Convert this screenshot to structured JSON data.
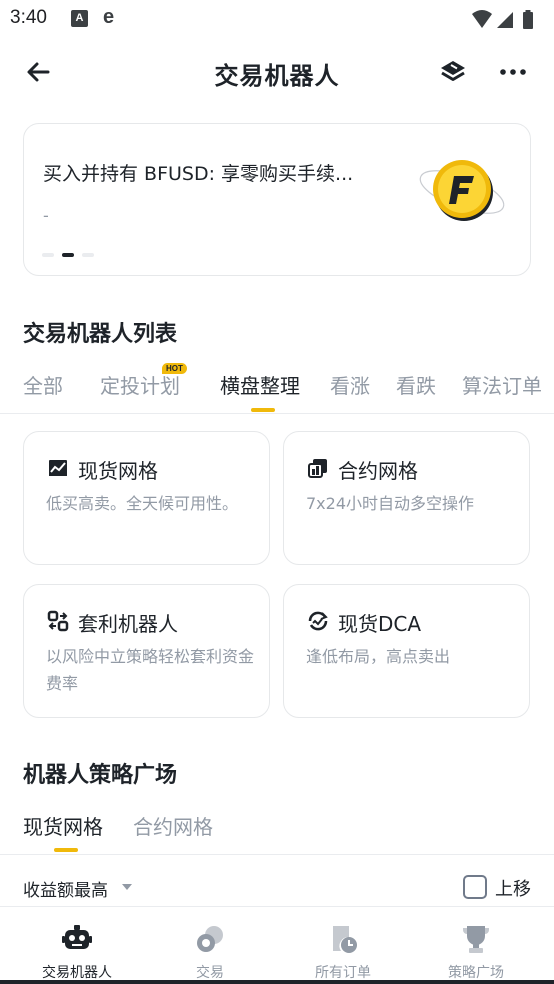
{
  "status_bar": {
    "time": "3:40",
    "icons": [
      "font-a-icon",
      "edge-browser-icon",
      "wifi-icon",
      "signal-icon",
      "battery-icon"
    ]
  },
  "header": {
    "title": "交易机器人",
    "icons": [
      "back-arrow-icon",
      "layers-icon",
      "more-icon"
    ]
  },
  "banner": {
    "title": "买入并持有 BFUSD: 享零购买手续...",
    "subtitle": "-",
    "slide_count": 3,
    "active_slide": 2
  },
  "bot_list": {
    "title": "交易机器人列表",
    "tabs": [
      {
        "label": "全部"
      },
      {
        "label": "定投计划",
        "badge": "HOT"
      },
      {
        "label": "横盘整理"
      },
      {
        "label": "看涨"
      },
      {
        "label": "看跌"
      },
      {
        "label": "算法订单"
      }
    ],
    "active_tab": 2,
    "cards": [
      {
        "title": "现货网格",
        "desc": "低买高卖。全天候可用性。",
        "icon": "spot-grid-icon"
      },
      {
        "title": "合约网格",
        "desc": "7x24小时自动多空操作",
        "icon": "futures-grid-icon"
      },
      {
        "title": "套利机器人",
        "desc": "以风险中立策略轻松套利资金费率",
        "icon": "arbitrage-icon"
      },
      {
        "title": "现货DCA",
        "desc": "逢低布局，高点卖出",
        "icon": "dca-icon"
      }
    ]
  },
  "strategy_plaza": {
    "title": "机器人策略广场",
    "tabs": [
      {
        "label": "现货网格"
      },
      {
        "label": "合约网格"
      }
    ],
    "active_tab": 0,
    "sort_label": "收益额最高",
    "checkbox_label": "上移",
    "checkbox_checked": false
  },
  "bottom_nav": {
    "items": [
      {
        "label": "交易机器人",
        "icon": "robot-icon",
        "active": true
      },
      {
        "label": "交易",
        "icon": "trade-icon",
        "active": false
      },
      {
        "label": "所有订单",
        "icon": "orders-icon",
        "active": false
      },
      {
        "label": "策略广场",
        "icon": "trophy-icon",
        "active": false
      }
    ]
  },
  "colors": {
    "accent": "#f0b90b",
    "text_primary": "#1e2329",
    "text_secondary": "#929aa5",
    "border": "#e6e8ea"
  }
}
